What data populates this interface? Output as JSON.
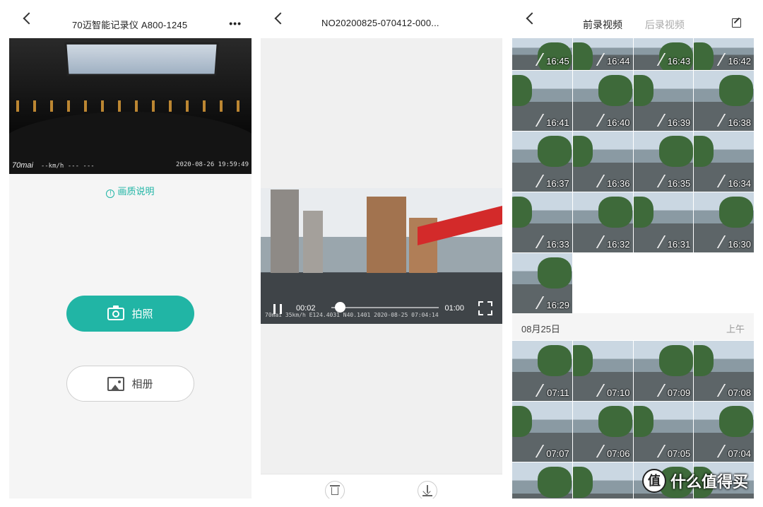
{
  "panel1": {
    "title": "70迈智能记录仪 A800-1245",
    "more_icon": "more-icon",
    "preview": {
      "logo": "70mai",
      "speed": "--km/h --- ---",
      "timestamp": "2020-08-26 19:59:49"
    },
    "quality_link": "画质说明",
    "capture_button": "拍照",
    "album_button": "相册"
  },
  "panel2": {
    "title": "NO20200825-070412-000...",
    "player": {
      "current_time": "00:02",
      "duration": "01:00",
      "progress": 0.033,
      "osd": "35km/h E124.4031 N40.1401   2020-08-25 07:04:14",
      "logo": "70mai"
    },
    "delete_icon": "trash-icon",
    "download_icon": "download-icon"
  },
  "panel3": {
    "tabs": [
      "前录视频",
      "后录视频"
    ],
    "active_tab": 0,
    "edit_icon": "edit-icon",
    "today_rows": [
      [
        "16:45",
        "16:44",
        "16:43",
        "16:42"
      ],
      [
        "16:41",
        "16:40",
        "16:39",
        "16:38"
      ],
      [
        "16:37",
        "16:36",
        "16:35",
        "16:34"
      ],
      [
        "16:33",
        "16:32",
        "16:31",
        "16:30"
      ],
      [
        "16:29"
      ]
    ],
    "group_date": "08月25日",
    "group_period": "上午",
    "group_rows": [
      [
        "07:11",
        "07:10",
        "07:09",
        "07:08"
      ],
      [
        "07:07",
        "07:06",
        "07:05",
        "07:04"
      ],
      [
        "",
        "",
        "",
        ""
      ]
    ]
  },
  "watermark": {
    "badge": "值",
    "text": "什么值得买"
  }
}
